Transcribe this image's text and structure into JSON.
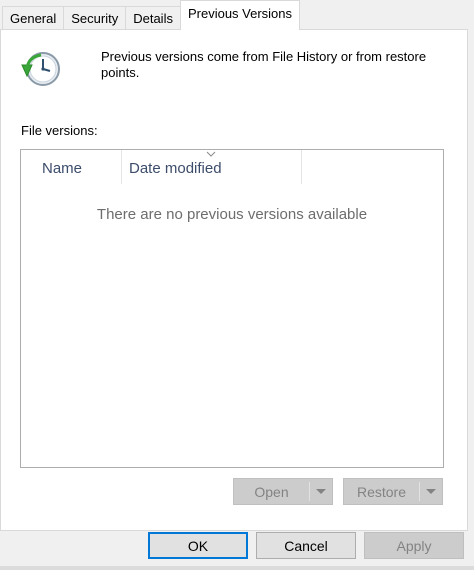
{
  "tabs": [
    {
      "label": "General"
    },
    {
      "label": "Security"
    },
    {
      "label": "Details"
    },
    {
      "label": "Previous Versions"
    }
  ],
  "active_tab": "Previous Versions",
  "info": {
    "icon": "restore-clock-icon",
    "text": "Previous versions come from File History or from restore points."
  },
  "file_versions": {
    "label": "File versions:",
    "columns": [
      {
        "label": "Name"
      },
      {
        "label": "Date modified",
        "sorted": true
      }
    ],
    "empty_message": "There are no previous versions available"
  },
  "actions": {
    "open_label": "Open",
    "restore_label": "Restore"
  },
  "dialog": {
    "ok_label": "OK",
    "cancel_label": "Cancel",
    "apply_label": "Apply"
  },
  "colors": {
    "accent": "#0078d7",
    "header_text": "#3c4c6b",
    "disabled_text": "#838383"
  }
}
